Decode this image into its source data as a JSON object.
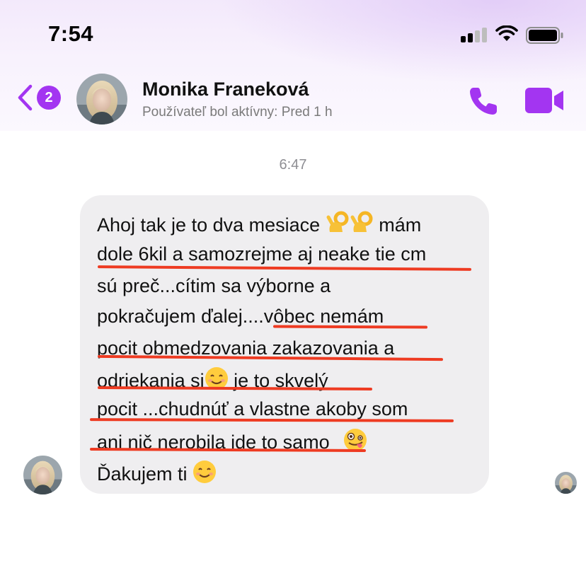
{
  "status_bar": {
    "time": "7:54",
    "icons": [
      "cellular-signal-icon",
      "wifi-icon",
      "battery-icon"
    ]
  },
  "header": {
    "back_icon": "chevron-left-icon",
    "unread_badge": "2",
    "contact_name": "Monika Franeková",
    "active_status": "Používateľ bol aktívny: Pred 1 h",
    "actions": [
      "phone-icon",
      "video-camera-icon"
    ]
  },
  "conversation": {
    "timestamp": "6:47",
    "message": {
      "lines": [
        "Ahoj tak je to dva mesiace",
        "mám",
        "dole 6kil a samozrejme aj neake tie cm",
        "sú preč...cítim sa výborne  a",
        "pokračujem ďalej....vôbec nemám",
        "pocit obmedzovania  zakazovania a",
        "odriekania si",
        "je to skvelý",
        "pocit ...chudnúť a vlastne akoby som",
        "ani nič nerobila ide to samo",
        "Ďakujem ti"
      ],
      "emojis": [
        "ok-hand-icon",
        "ok-hand-icon",
        "smiling-face-icon",
        "zany-face-icon",
        "smiling-face-icon"
      ],
      "annotation_color": "#ee3b22"
    }
  },
  "colors": {
    "accent": "#a335f1",
    "bubble": "#efeef0",
    "header_gradient": "#f3e9fb"
  }
}
